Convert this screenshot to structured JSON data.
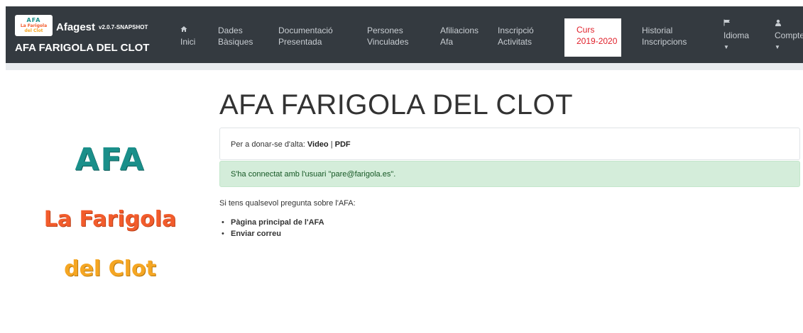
{
  "header": {
    "logo": {
      "line1": "AFA",
      "line2": "La Farigola",
      "line3": "del Clot"
    },
    "app_name": "Afagest",
    "app_version": "v2.0.7-SNAPSHOT",
    "org_name": "AFA FARIGOLA DEL CLOT"
  },
  "nav": {
    "inici": {
      "icon": "home-icon",
      "label": "Inici"
    },
    "dades": {
      "line1": "Dades",
      "line2": "Bàsiques"
    },
    "documentacio": {
      "line1": "Documentació",
      "line2": "Presentada"
    },
    "persones": {
      "line1": "Persones",
      "line2": "Vinculades"
    },
    "afiliacions": {
      "line1": "Afiliacions",
      "line2": "Afa"
    },
    "inscripcio": {
      "line1": "Inscripció",
      "line2": "Activitats"
    },
    "curs": {
      "line1": "Curs",
      "line2": "2019-2020"
    },
    "historial": {
      "line1": "Historial",
      "line2": "Inscripcions"
    },
    "idioma": {
      "icon": "flag-icon",
      "label": "Idioma"
    },
    "compte": {
      "icon": "user-icon",
      "label": "Compte"
    }
  },
  "sidebar_logo": {
    "line1": "AFA",
    "line2": "La Farigola",
    "line3": "del Clot"
  },
  "main": {
    "title": "AFA FARIGOLA DEL CLOT",
    "signup_prefix": "Per a donar-se d'alta:",
    "video_link": "Video",
    "separator": "|",
    "pdf_link": "PDF",
    "alert": "S'ha connectat amb l'usuari \"pare@farigola.es\".",
    "question": "Si tens qualsevol pregunta sobre l'AFA:",
    "links": [
      "Pàgina principal de l'AFA",
      "Enviar correu"
    ]
  },
  "colors": {
    "navbar": "#343a40",
    "active_text": "#e0202a",
    "alert_bg": "#d4edda"
  }
}
